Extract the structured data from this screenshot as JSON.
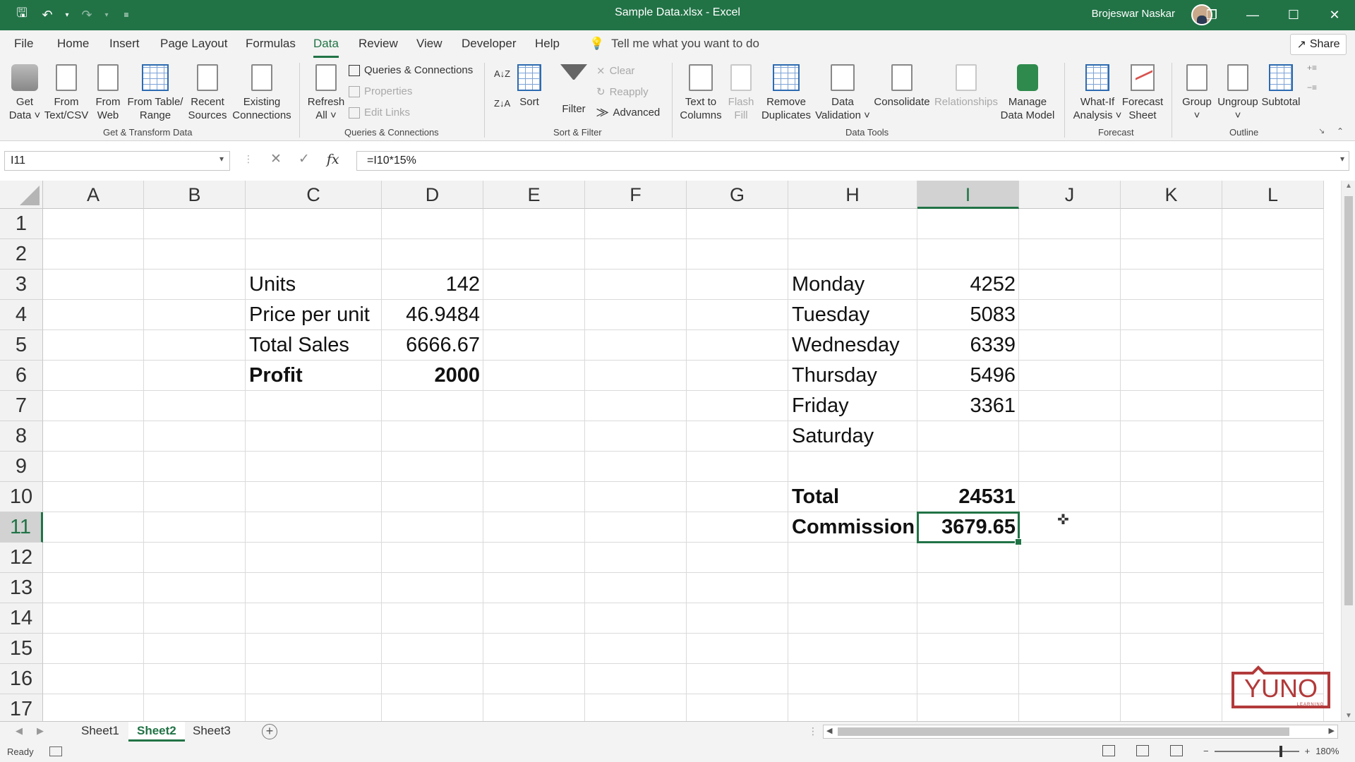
{
  "window": {
    "title": "Sample Data.xlsx  -  Excel",
    "user": "Brojeswar Naskar",
    "controls": [
      "restore-ribbon",
      "minimize",
      "maximize",
      "close"
    ]
  },
  "ribbon_tabs": [
    "File",
    "Home",
    "Insert",
    "Page Layout",
    "Formulas",
    "Data",
    "Review",
    "View",
    "Developer",
    "Help"
  ],
  "active_tab": "Data",
  "tell_me": "Tell me what you want to do",
  "share_label": "Share",
  "ribbon": {
    "get_transform": {
      "label": "Get & Transform Data",
      "get_data": [
        "Get",
        "Data ˅"
      ],
      "from_text": [
        "From",
        "Text/CSV"
      ],
      "from_web": [
        "From",
        "Web"
      ],
      "from_table": [
        "From Table/",
        "Range"
      ],
      "recent_sources": [
        "Recent",
        "Sources"
      ],
      "existing_connections": [
        "Existing",
        "Connections"
      ]
    },
    "queries": {
      "label": "Queries & Connections",
      "refresh_all": [
        "Refresh",
        "All ˅"
      ],
      "queries_connections": "Queries & Connections",
      "properties": "Properties",
      "edit_links": "Edit Links"
    },
    "sort_filter": {
      "label": "Sort & Filter",
      "sort": "Sort",
      "filter": "Filter",
      "clear": "Clear",
      "reapply": "Reapply",
      "advanced": "Advanced"
    },
    "data_tools": {
      "label": "Data Tools",
      "text_to_columns": [
        "Text to",
        "Columns"
      ],
      "flash_fill": [
        "Flash",
        "Fill"
      ],
      "remove_duplicates": [
        "Remove",
        "Duplicates"
      ],
      "data_validation": [
        "Data",
        "Validation ˅"
      ],
      "consolidate": "Consolidate",
      "relationships": "Relationships",
      "manage_data_model": [
        "Manage",
        "Data Model"
      ]
    },
    "forecast": {
      "label": "Forecast",
      "what_if": [
        "What-If",
        "Analysis ˅"
      ],
      "forecast_sheet": [
        "Forecast",
        "Sheet"
      ]
    },
    "outline": {
      "label": "Outline",
      "group": [
        "Group",
        "˅"
      ],
      "ungroup": [
        "Ungroup",
        "˅"
      ],
      "subtotal": "Subtotal"
    }
  },
  "formula_bar": {
    "name_box": "I11",
    "formula": "=I10*15%"
  },
  "columns": [
    "A",
    "B",
    "C",
    "D",
    "E",
    "F",
    "G",
    "H",
    "I",
    "J",
    "K",
    "L"
  ],
  "selected_column": "I",
  "rows": [
    "1",
    "2",
    "3",
    "4",
    "5",
    "6",
    "7",
    "8",
    "9",
    "10",
    "11",
    "12",
    "13",
    "14",
    "15",
    "16",
    "17"
  ],
  "selected_row": "11",
  "cells": {
    "C3": "Units",
    "D3": "142",
    "C4": "Price per unit",
    "D4": "46.9484",
    "C5": "Total Sales",
    "D5": "6666.67",
    "C6": "Profit",
    "D6": "2000",
    "H3": "Monday",
    "I3": "4252",
    "H4": "Tuesday",
    "I4": "5083",
    "H5": "Wednesday",
    "I5": "6339",
    "H6": "Thursday",
    "I6": "5496",
    "H7": "Friday",
    "I7": "3361",
    "H8": "Saturday",
    "H10": "Total",
    "I10": "24531",
    "H11": "Commission",
    "I11": "3679.65"
  },
  "sheets": [
    "Sheet1",
    "Sheet2",
    "Sheet3"
  ],
  "active_sheet": "Sheet2",
  "status": {
    "ready": "Ready",
    "zoom": "180%"
  },
  "watermark": {
    "brand": "YUNO",
    "tagline": "LEARNING"
  },
  "colors": {
    "excel_green": "#217346",
    "logo_red": "#c0392b"
  }
}
